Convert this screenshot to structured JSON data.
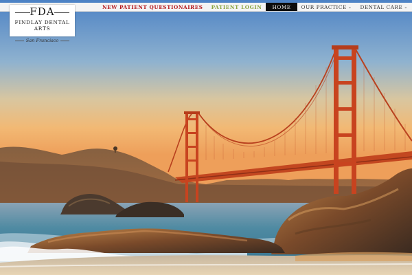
{
  "logo": {
    "mark": "FDA",
    "name": "Findlay Dental Arts",
    "sub": "San Francisco"
  },
  "nav": {
    "items": [
      {
        "label": "New Patient Questionaires"
      },
      {
        "label": "Patient Login"
      },
      {
        "label": "Home"
      },
      {
        "label": "Our Practice"
      },
      {
        "label": "Dental Care"
      }
    ]
  },
  "hero": {
    "subject": "golden-gate-bridge-sunset",
    "colors": {
      "sky_top": "#4f86c6",
      "sky_mid": "#c8b48e",
      "sky_low": "#f0b06a",
      "bridge": "#c8431f",
      "sea": "#3f7f96"
    }
  }
}
